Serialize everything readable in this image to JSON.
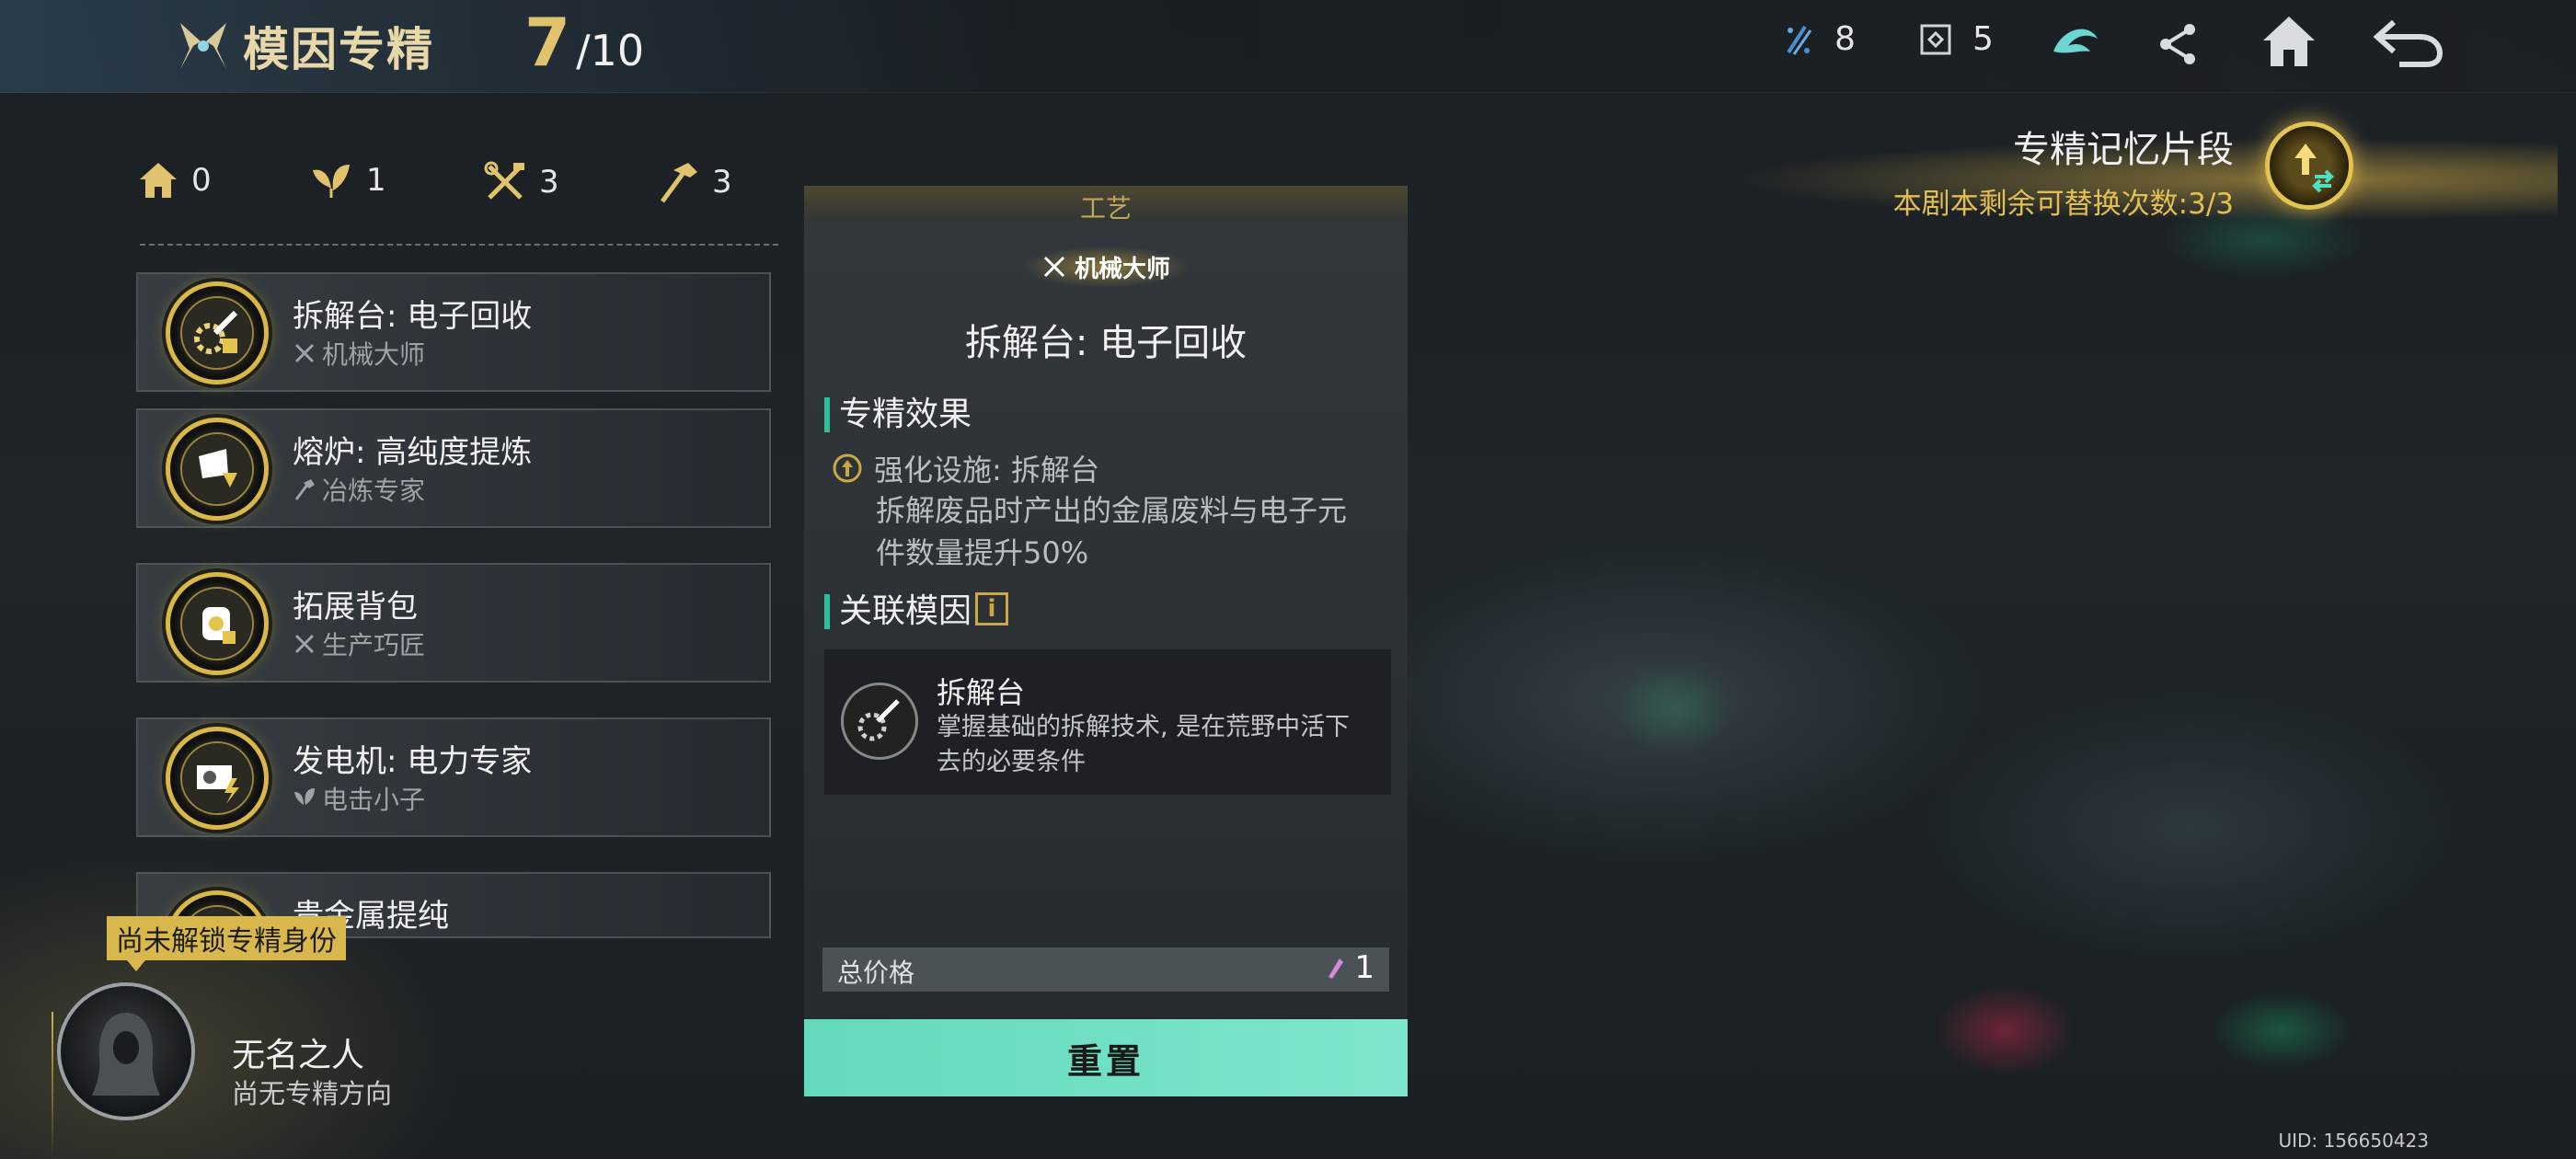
{
  "header": {
    "title": "模因专精",
    "progress_current": "7",
    "progress_total": "/10",
    "resource_1": "8",
    "resource_2": "5"
  },
  "stats": [
    {
      "icon": "home-icon",
      "value": "0"
    },
    {
      "icon": "leaf-icon",
      "value": "1"
    },
    {
      "icon": "tools-cross-icon",
      "value": "3"
    },
    {
      "icon": "hammer-icon",
      "value": "3"
    }
  ],
  "list": [
    {
      "name": "拆解台: 电子回收",
      "sub": "机械大师",
      "sub_icon": "tools-cross-icon"
    },
    {
      "name": "熔炉: 高纯度提炼",
      "sub": "冶炼专家",
      "sub_icon": "hammer-icon"
    },
    {
      "name": "拓展背包",
      "sub": "生产巧匠",
      "sub_icon": "tools-cross-icon"
    },
    {
      "name": "发电机: 电力专家",
      "sub": "电击小子",
      "sub_icon": "leaf-icon"
    },
    {
      "name": "贵金属提纯"
    }
  ],
  "profile": {
    "locked_tag": "尚未解锁专精身份",
    "name": "无名之人",
    "direction": "尚无专精方向"
  },
  "detail": {
    "category": "工艺",
    "badge": "机械大师",
    "title": "拆解台: 电子回收",
    "effect_title": "专精效果",
    "effect_line": "强化设施: 拆解台",
    "effect_desc": "拆解废品时产出的金属废料与电子元件数量提升50%",
    "related_title": "关联模因",
    "info_glyph": "i",
    "gene_name": "拆解台",
    "gene_desc": "掌握基础的拆解技术, 是在荒野中活下去的必要条件",
    "price_label": "总价格",
    "price_value": "1",
    "reset_label": "重置"
  },
  "memory": {
    "title": "专精记忆片段",
    "subtitle": "本剧本剩余可替换次数:3/3"
  },
  "uid": "UID: 156650423",
  "colors": {
    "gold": "#e0c36c",
    "teal_button": "#6fdfc3",
    "accent_teal": "#2fbf9b"
  }
}
